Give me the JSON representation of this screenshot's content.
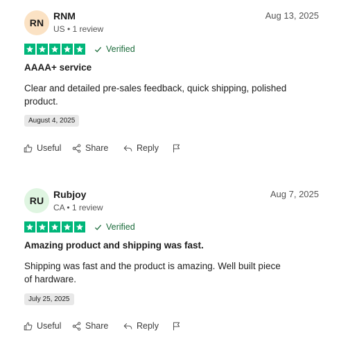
{
  "colors": {
    "star_green": "#00b67a",
    "verified_green": "#1a6b3a",
    "avatar_rn": "#fbe2c4",
    "avatar_ru": "#dff5e1"
  },
  "reviews": [
    {
      "initials": "RN",
      "name": "RNM",
      "meta": "US • 1 review",
      "date": "Aug 13, 2025",
      "rating": 5,
      "verified_label": "Verified",
      "title": "AAAA+ service",
      "body": "Clear and detailed pre-sales feedback, quick shipping, polished product.",
      "experience_date": "August 4, 2025",
      "actions": {
        "useful": "Useful",
        "share": "Share",
        "reply": "Reply"
      }
    },
    {
      "initials": "RU",
      "name": "Rubjoy",
      "meta": "CA • 1 review",
      "date": "Aug 7, 2025",
      "rating": 5,
      "verified_label": "Verified",
      "title": "Amazing product and shipping was fast.",
      "body": "Shipping was fast and the product is amazing. Well built piece of hardware.",
      "experience_date": "July 25, 2025",
      "actions": {
        "useful": "Useful",
        "share": "Share",
        "reply": "Reply"
      }
    }
  ]
}
